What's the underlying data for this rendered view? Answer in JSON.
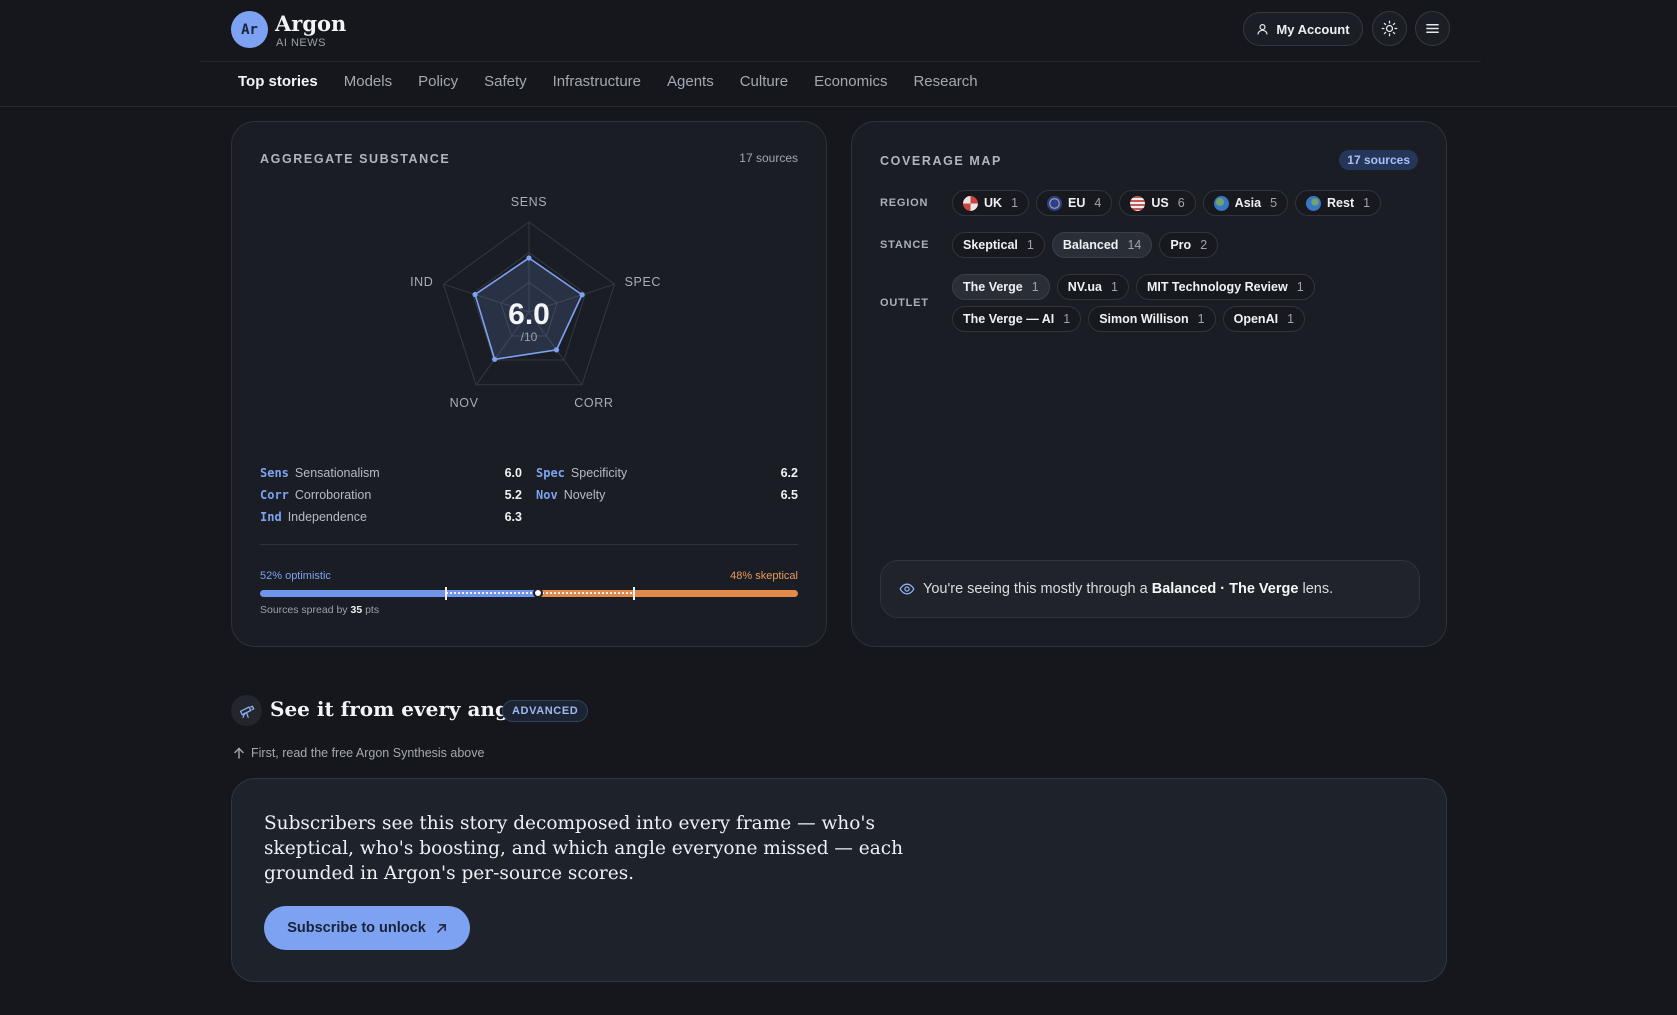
{
  "header": {
    "logo_initials": "Ar",
    "brand": "Argon",
    "brand_sub": "AI NEWS",
    "account_label": "My Account"
  },
  "nav": [
    "Top stories",
    "Models",
    "Policy",
    "Safety",
    "Infrastructure",
    "Agents",
    "Culture",
    "Economics",
    "Research"
  ],
  "aggregate": {
    "title": "AGGREGATE SUBSTANCE",
    "sources": "17 sources",
    "score": "6.0",
    "score_suffix": "/10",
    "axes": [
      "SENS",
      "SPEC",
      "CORR",
      "NOV",
      "IND"
    ],
    "metrics": [
      {
        "abbr": "Sens",
        "name": "Sensationalism",
        "value": "6.0"
      },
      {
        "abbr": "Spec",
        "name": "Specificity",
        "value": "6.2"
      },
      {
        "abbr": "Corr",
        "name": "Corroboration",
        "value": "5.2"
      },
      {
        "abbr": "Nov",
        "name": "Novelty",
        "value": "6.5"
      },
      {
        "abbr": "Ind",
        "name": "Independence",
        "value": "6.3"
      }
    ],
    "optimistic_label": "52% optimistic",
    "skeptical_label": "48% skeptical",
    "optimistic_pct": 52,
    "spread_prefix": "Sources spread by",
    "spread_value": "35",
    "spread_suffix": "pts"
  },
  "chart_data": {
    "type": "radar",
    "categories": [
      "SENS",
      "SPEC",
      "CORR",
      "NOV",
      "IND"
    ],
    "values": [
      6.0,
      6.2,
      5.2,
      6.5,
      6.3
    ],
    "range": [
      0,
      10
    ],
    "center_label": "6.0"
  },
  "coverage": {
    "title": "COVERAGE MAP",
    "badge": "17 sources",
    "region_label": "REGION",
    "stance_label": "STANCE",
    "outlet_label": "OUTLET",
    "regions": [
      {
        "name": "UK",
        "count": "1"
      },
      {
        "name": "EU",
        "count": "4"
      },
      {
        "name": "US",
        "count": "6"
      },
      {
        "name": "Asia",
        "count": "5"
      },
      {
        "name": "Rest",
        "count": "1"
      }
    ],
    "stances": [
      {
        "name": "Skeptical",
        "count": "1"
      },
      {
        "name": "Balanced",
        "count": "14"
      },
      {
        "name": "Pro",
        "count": "2"
      }
    ],
    "outlets": [
      {
        "name": "The Verge",
        "count": "1"
      },
      {
        "name": "NV.ua",
        "count": "1"
      },
      {
        "name": "MIT Technology Review",
        "count": "1"
      },
      {
        "name": "The Verge — AI",
        "count": "1"
      },
      {
        "name": "Simon Willison",
        "count": "1"
      },
      {
        "name": "OpenAI",
        "count": "1"
      }
    ],
    "lens_prefix": "You're seeing this mostly through a",
    "lens_stance": "Balanced",
    "lens_sep": "·",
    "lens_outlet": "The Verge",
    "lens_suffix": "lens."
  },
  "advanced": {
    "title": "See it from every angle",
    "badge": "ADVANCED",
    "note": "First, read the free Argon Synthesis above",
    "pitch": "Subscribers see this story decomposed into every frame — who's skeptical, who's boosting, and which angle everyone missed — each grounded in Argon's per-source scores.",
    "cta": "Subscribe to unlock"
  },
  "colors": {
    "accent": "#7ea2f2",
    "skeptical": "#e3894a",
    "background": "#15171c"
  }
}
